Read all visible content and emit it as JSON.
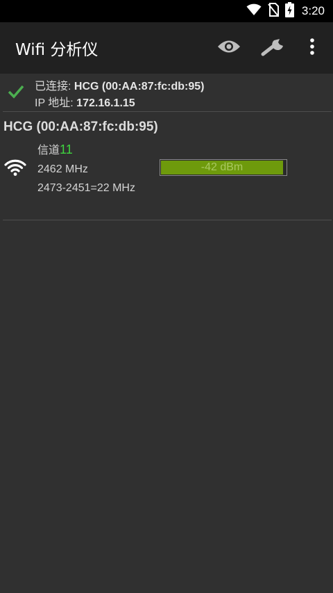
{
  "status_bar": {
    "time": "3:20",
    "icons": [
      "wifi-icon",
      "no-sim-icon",
      "battery-charging-icon"
    ]
  },
  "app_bar": {
    "title": "Wifi 分析仪",
    "actions": [
      "eye-icon",
      "wrench-icon",
      "overflow-menu-icon"
    ]
  },
  "connection": {
    "connected_label": "已连接: ",
    "connected_value": "HCG (00:AA:87:fc:db:95)",
    "ip_label": "IP 地址: ",
    "ip_value": "172.16.1.15",
    "icon": "check-icon"
  },
  "access_points": [
    {
      "ssid": "HCG (00:AA:87:fc:db:95)",
      "channel_label": "信道",
      "channel": "11",
      "frequency": "2462 MHz",
      "width": "2473-2451=22 MHz",
      "signal_text": "-42 dBm",
      "signal_fraction": 0.98,
      "icon": "wifi-signal-icon"
    }
  ],
  "colors": {
    "background": "#303030",
    "app_bar": "#212121",
    "accent_green": "#3fd43f",
    "signal_bar": "#6e9a0c"
  }
}
